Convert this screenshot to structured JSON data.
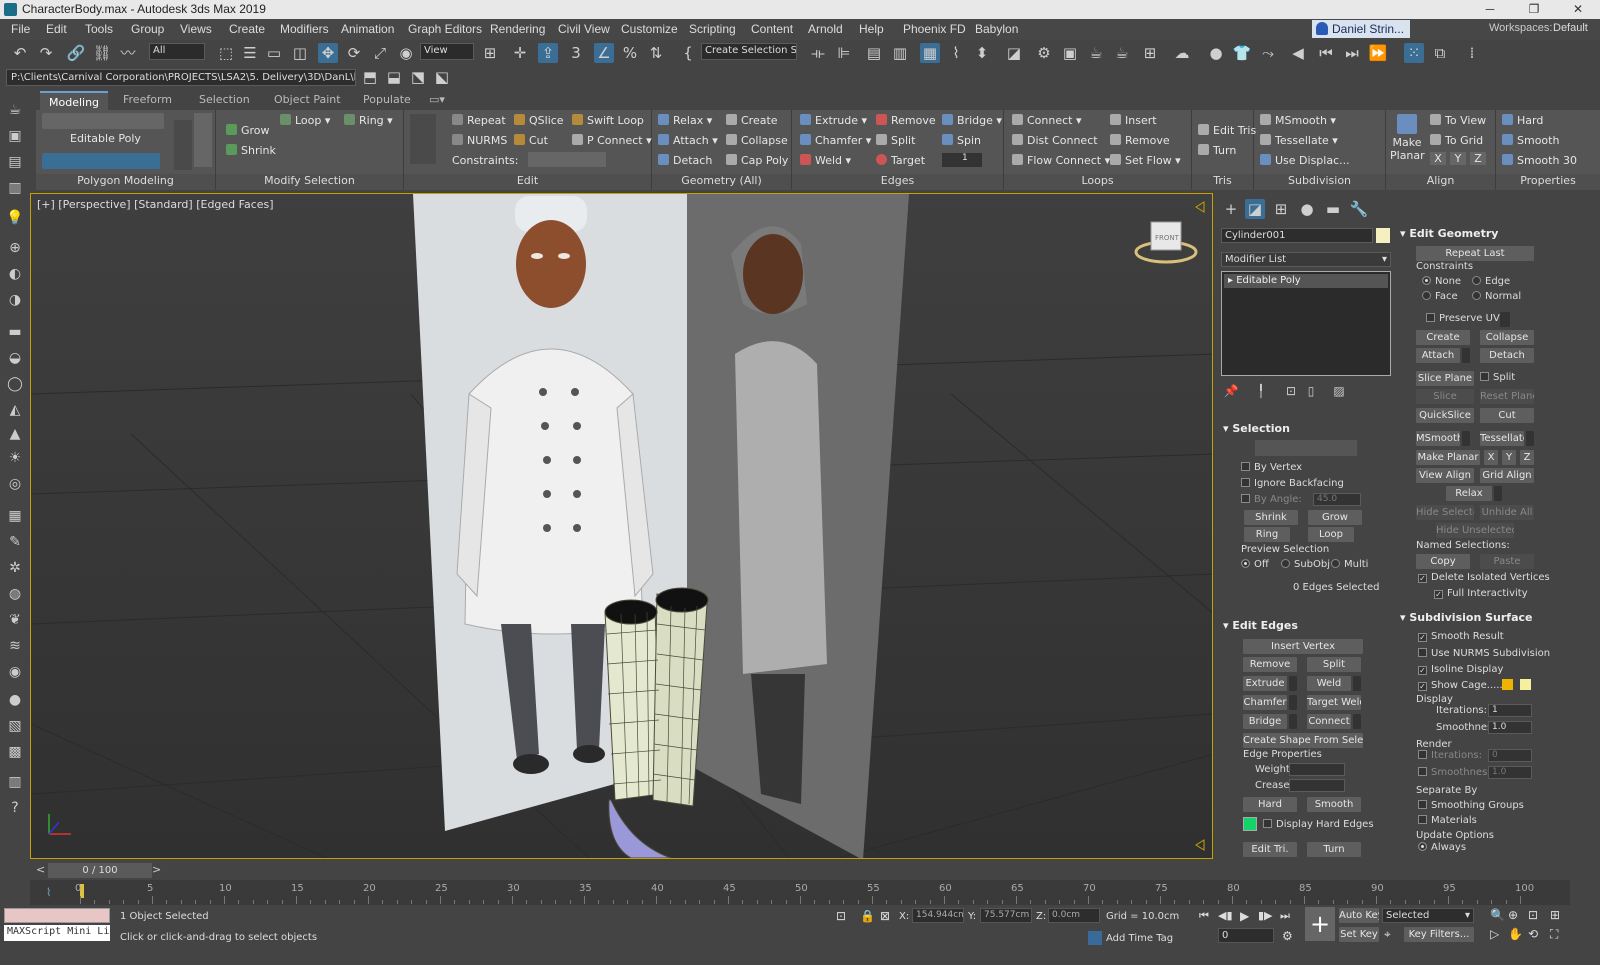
{
  "window": {
    "title": "CharacterBody.max - Autodesk 3ds Max 2019"
  },
  "menu": [
    "File",
    "Edit",
    "Tools",
    "Group",
    "Views",
    "Create",
    "Modifiers",
    "Animation",
    "Graph Editors",
    "Rendering",
    "Civil View",
    "Customize",
    "Scripting",
    "Content",
    "Arnold",
    "Help",
    "Phoenix FD",
    "Babylon"
  ],
  "user": "Daniel Strin...",
  "workspace_label": "Workspaces:",
  "workspace": "Default",
  "toolbar": {
    "filter": "All",
    "refcoord": "View",
    "selset": "Create Selection Se"
  },
  "path": "P:\\Clients\\Carnival Corporation\\PROJECTS\\LSA2\\5. Delivery\\3D\\DanL\\lsa2-master",
  "ribbon_tabs": [
    "Modeling",
    "Freeform",
    "Selection",
    "Object Paint",
    "Populate"
  ],
  "ribbon": {
    "poly": {
      "label": "Editable Poly",
      "footer": "Polygon Modeling"
    },
    "modsel": {
      "grow": "Grow",
      "shrink": "Shrink",
      "loop": "Loop",
      "ring": "Ring",
      "footer": "Modify Selection"
    },
    "edit": {
      "repeat": "Repeat",
      "qslice": "QSlice",
      "swift": "Swift Loop",
      "nurms": "NURMS",
      "cut": "Cut",
      "pconnect": "P Connect",
      "constraints": "Constraints:",
      "footer": "Edit"
    },
    "geom": {
      "relax": "Relax",
      "create": "Create",
      "attach": "Attach",
      "collapse": "Collapse",
      "detach": "Detach",
      "cappoly": "Cap Poly",
      "footer": "Geometry (All)"
    },
    "edges": {
      "extrude": "Extrude",
      "remove": "Remove",
      "bridge": "Bridge",
      "chamfer": "Chamfer",
      "split": "Split",
      "spin": "Spin",
      "weld": "Weld",
      "target": "Target",
      "spinval": "1",
      "footer": "Edges"
    },
    "loops": {
      "connect": "Connect",
      "insert": "Insert",
      "distconnect": "Dist Connect",
      "remove": "Remove",
      "flowconnect": "Flow Connect",
      "setflow": "Set Flow",
      "footer": "Loops"
    },
    "tris": {
      "edittris": "Edit Tris",
      "turn": "Turn",
      "footer": "Tris"
    },
    "subdiv": {
      "msmooth": "MSmooth",
      "tessellate": "Tessellate",
      "usedisplace": "Use Displac...",
      "footer": "Subdivision"
    },
    "align": {
      "makeplanar": "Make Planar",
      "toview": "To View",
      "togrid": "To Grid",
      "x": "X",
      "y": "Y",
      "z": "Z",
      "footer": "Align"
    },
    "props": {
      "hard": "Hard",
      "smooth": "Smooth",
      "smooth30": "Smooth 30",
      "footer": "Properties"
    }
  },
  "viewport": {
    "label": "[+] [Perspective] [Standard] [Edged Faces]",
    "viewcube": "FRONT"
  },
  "cmd": {
    "objname": "Cylinder001",
    "modlist": "Modifier List",
    "stackitem": "Editable Poly",
    "selection": {
      "title": "Selection",
      "byvertex": "By Vertex",
      "ignoreback": "Ignore Backfacing",
      "byangle": "By Angle:",
      "angle": "45.0",
      "shrink": "Shrink",
      "grow": "Grow",
      "ring": "Ring",
      "loop": "Loop",
      "preview": "Preview Selection",
      "off": "Off",
      "subobj": "SubObj",
      "multi": "Multi",
      "status": "0 Edges Selected"
    },
    "editedges": {
      "title": "Edit Edges",
      "insertvertex": "Insert Vertex",
      "remove": "Remove",
      "split": "Split",
      "extrude": "Extrude",
      "weld": "Weld",
      "chamfer": "Chamfer",
      "targetweld": "Target Weld",
      "bridge": "Bridge",
      "connect": "Connect",
      "createshape": "Create Shape From Selection",
      "edgeprops": "Edge Properties",
      "weight": "Weight:",
      "crease": "Crease:",
      "hard": "Hard",
      "smooth": "Smooth",
      "displayhard": "Display Hard Edges",
      "edittri": "Edit Tri.",
      "turn": "Turn"
    }
  },
  "props": {
    "editgeom": "Edit Geometry",
    "repeatlast": "Repeat Last",
    "constraints": "Constraints",
    "none": "None",
    "edge": "Edge",
    "face": "Face",
    "normal": "Normal",
    "preserveuvs": "Preserve UVs",
    "create": "Create",
    "collapse": "Collapse",
    "attach": "Attach",
    "detach": "Detach",
    "sliceplane": "Slice Plane",
    "split": "Split",
    "slice": "Slice",
    "resetplane": "Reset Plane",
    "quickslice": "QuickSlice",
    "cut": "Cut",
    "msmooth": "MSmooth",
    "tessellate": "Tessellate",
    "makeplanar": "Make Planar",
    "x": "X",
    "y": "Y",
    "z": "Z",
    "viewalign": "View Align",
    "gridalign": "Grid Align",
    "relax": "Relax",
    "hidesel": "Hide Selected",
    "unhideall": "Unhide All",
    "hideunsel": "Hide Unselected",
    "namedsel": "Named Selections:",
    "copy": "Copy",
    "paste": "Paste",
    "deliso": "Delete Isolated Vertices",
    "fullinter": "Full Interactivity",
    "subdiv": "Subdivision Surface",
    "smoothresult": "Smooth Result",
    "usenurms": "Use NURMS Subdivision",
    "isoline": "Isoline Display",
    "showcage": "Show Cage......",
    "display": "Display",
    "iterations": "Iterations:",
    "iterval": "1",
    "smoothness": "Smoothness:",
    "smoothval": "1.0",
    "render": "Render",
    "riterval": "0",
    "rsmoothval": "1.0",
    "separate": "Separate By",
    "smoothgroups": "Smoothing Groups",
    "materials": "Materials",
    "update": "Update Options",
    "always": "Always"
  },
  "timeline": {
    "frame": "0 / 100",
    "ticks": [
      "0",
      "5",
      "10",
      "15",
      "20",
      "25",
      "30",
      "35",
      "40",
      "45",
      "50",
      "55",
      "60",
      "65",
      "70",
      "75",
      "80",
      "85",
      "90",
      "95",
      "100"
    ]
  },
  "status": {
    "script": "MAXScript Mini Li",
    "selected": "1 Object Selected",
    "prompt": "Click or click-and-drag to select objects",
    "x": "154.944cm",
    "y": "75.577cm",
    "z": "0.0cm",
    "grid": "Grid = 10.0cm",
    "addtimetag": "Add Time Tag",
    "autokey": "Auto Key",
    "setkey": "Set Key",
    "selectedkey": "Selected",
    "keyfilters": "Key Filters...",
    "frame": "0"
  }
}
